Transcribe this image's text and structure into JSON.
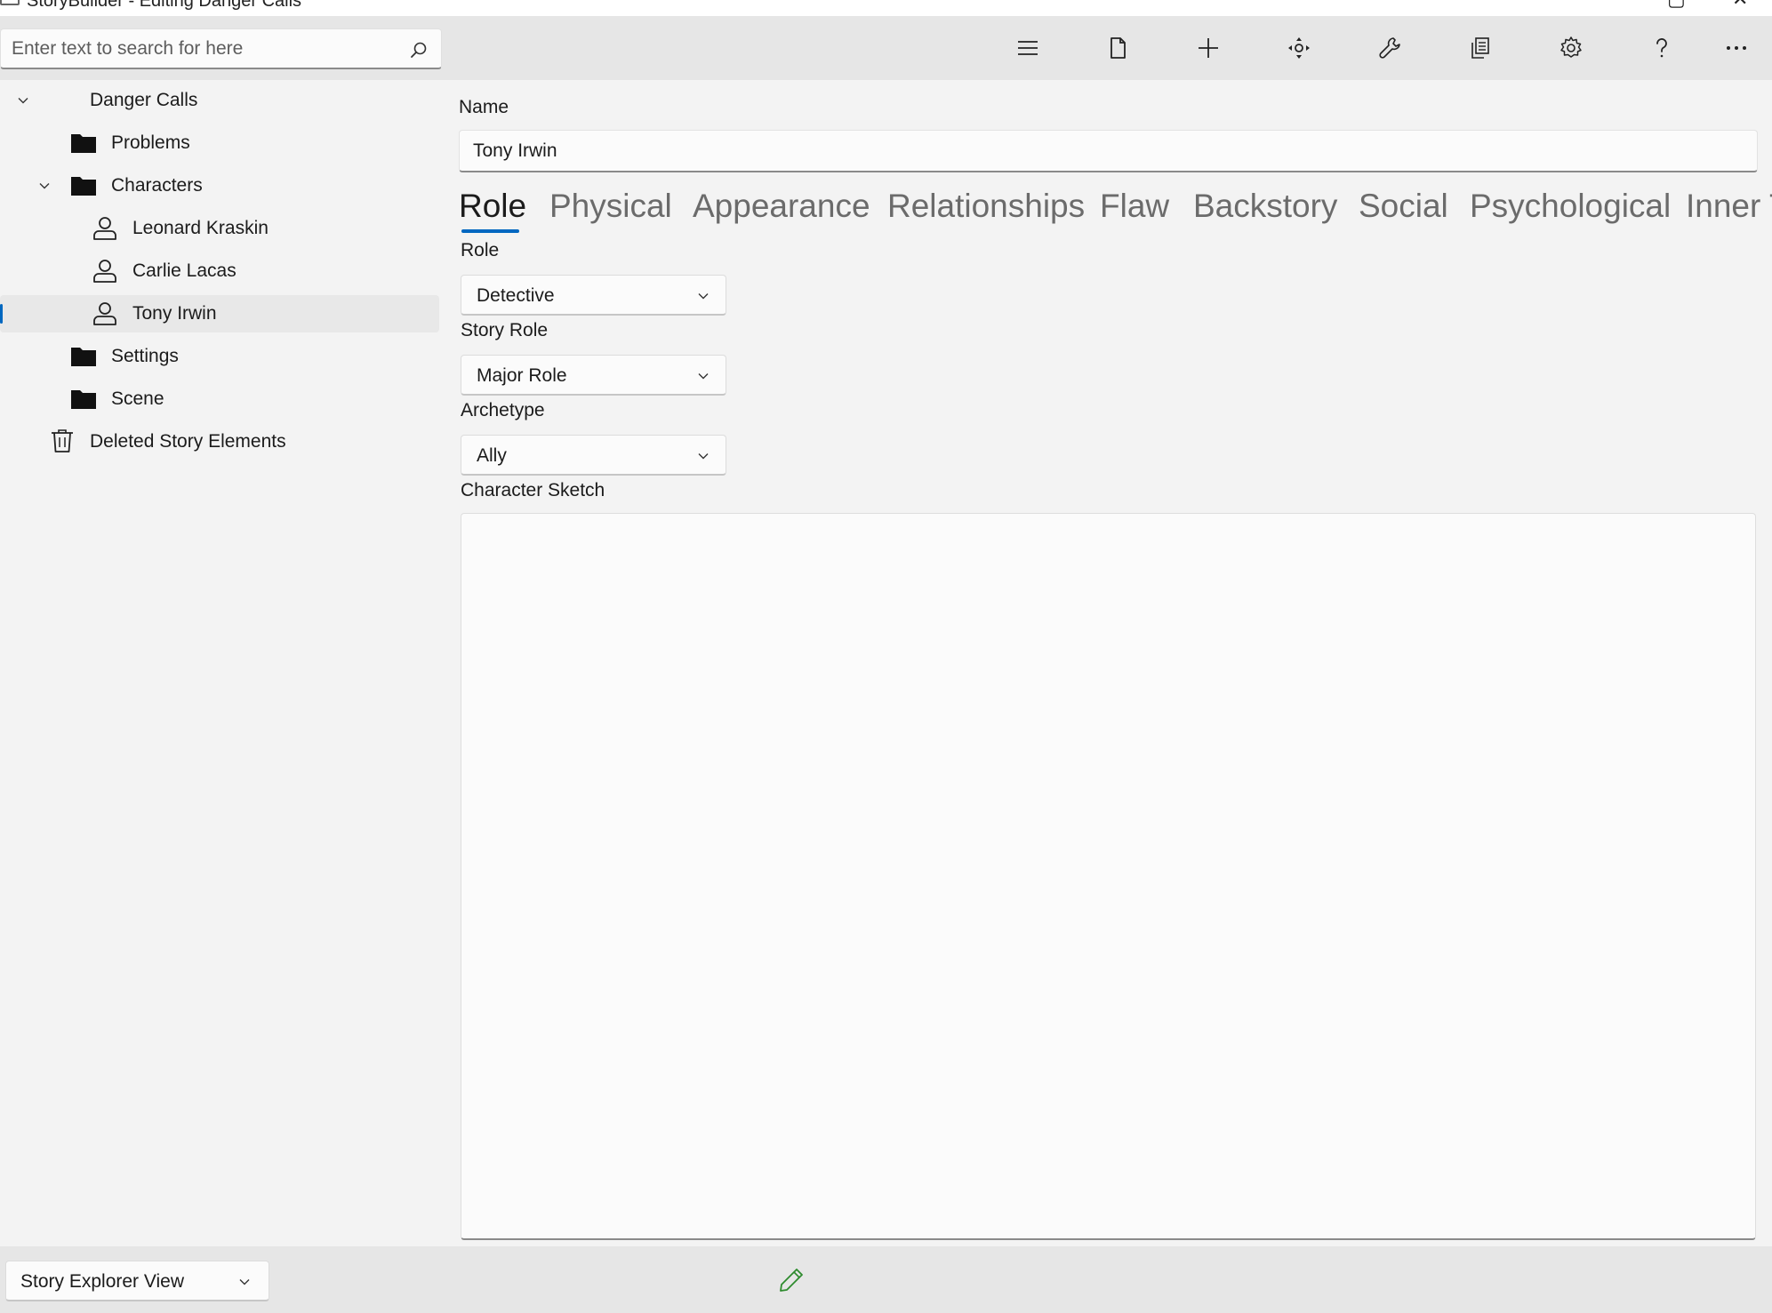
{
  "window": {
    "title": "StoryBuilder - Editing Danger Calls"
  },
  "search": {
    "placeholder": "Enter text to search for here"
  },
  "toolbar": {
    "buttons": [
      {
        "name": "menu-icon"
      },
      {
        "name": "new-file-icon"
      },
      {
        "name": "add-icon"
      },
      {
        "name": "move-icon"
      },
      {
        "name": "tools-icon"
      },
      {
        "name": "reports-icon"
      },
      {
        "name": "settings-icon"
      },
      {
        "name": "help-icon"
      },
      {
        "name": "more-icon"
      }
    ]
  },
  "tree": {
    "items": [
      {
        "label": "Danger Calls",
        "icon": "none",
        "expanded": true
      },
      {
        "label": "Problems",
        "icon": "folder-icon"
      },
      {
        "label": "Characters",
        "icon": "folder-icon",
        "expanded": true
      },
      {
        "label": "Leonard Kraskin",
        "icon": "person-icon"
      },
      {
        "label": "Carlie Lacas",
        "icon": "person-icon"
      },
      {
        "label": "Tony Irwin",
        "icon": "person-icon",
        "selected": true
      },
      {
        "label": "Settings",
        "icon": "folder-icon"
      },
      {
        "label": "Scene",
        "icon": "folder-icon"
      },
      {
        "label": "Deleted Story Elements",
        "icon": "trash-icon"
      }
    ]
  },
  "form": {
    "name_label": "Name",
    "name_value": "Tony Irwin",
    "tabs": [
      {
        "label": "Role",
        "active": true
      },
      {
        "label": "Physical"
      },
      {
        "label": "Appearance"
      },
      {
        "label": "Relationships"
      },
      {
        "label": "Flaw"
      },
      {
        "label": "Backstory"
      },
      {
        "label": "Social"
      },
      {
        "label": "Psychological"
      },
      {
        "label": "Inner T"
      }
    ],
    "role_label": "Role",
    "role_value": "Detective",
    "story_role_label": "Story Role",
    "story_role_value": "Major Role",
    "archetype_label": "Archetype",
    "archetype_value": "Ally",
    "sketch_label": "Character Sketch",
    "sketch_value": ""
  },
  "statusbar": {
    "view_value": "Story Explorer View"
  },
  "colors": {
    "accent": "#0067c0",
    "edit_icon": "#2e8b2e"
  }
}
